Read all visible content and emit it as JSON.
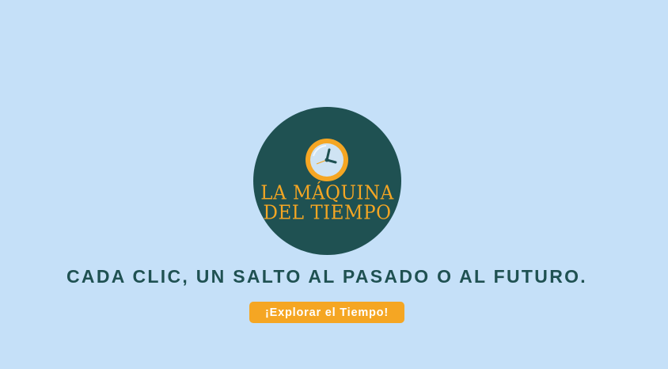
{
  "logo": {
    "line1": "LA MÁQUINA",
    "line2": "DEL TIEMPO",
    "icon": "clock-icon"
  },
  "tagline": "CADA CLIC, UN SALTO AL PASADO O AL FUTURO.",
  "cta": {
    "label": "¡Explorar el Tiempo!"
  },
  "colors": {
    "background": "#c5e0f8",
    "primary": "#1f5152",
    "accent": "#f5a623"
  }
}
